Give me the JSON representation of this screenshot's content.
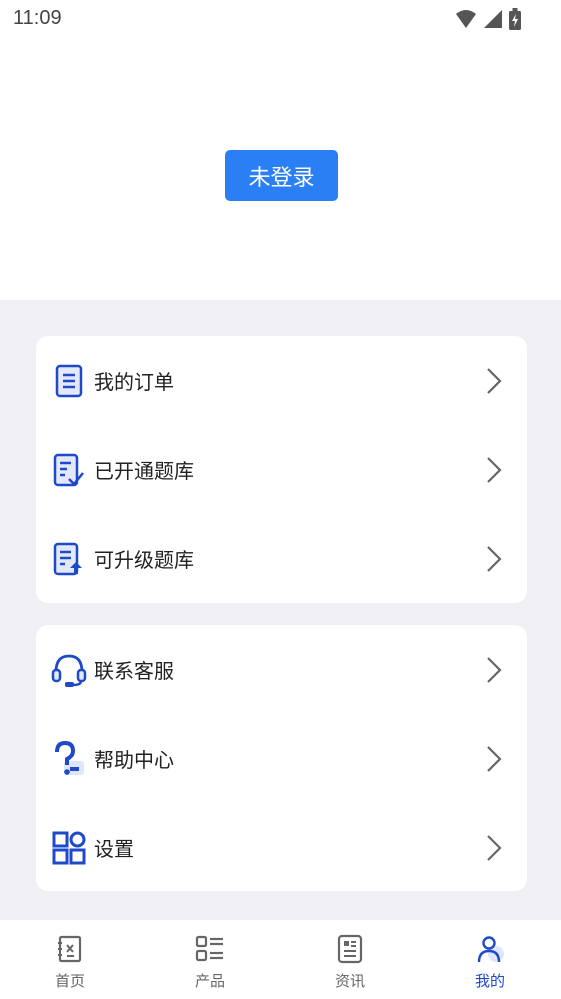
{
  "status_bar": {
    "time": "11:09"
  },
  "header": {
    "login_label": "未登录"
  },
  "menu_group1": {
    "items": [
      {
        "label": "我的订单",
        "icon": "order-icon"
      },
      {
        "label": "已开通题库",
        "icon": "opened-bank-icon"
      },
      {
        "label": "可升级题库",
        "icon": "upgrade-bank-icon"
      }
    ]
  },
  "menu_group2": {
    "items": [
      {
        "label": "联系客服",
        "icon": "headset-icon"
      },
      {
        "label": "帮助中心",
        "icon": "help-icon"
      },
      {
        "label": "设置",
        "icon": "settings-icon"
      }
    ]
  },
  "tabbar": {
    "tabs": [
      {
        "label": "首页",
        "icon": "home-icon"
      },
      {
        "label": "产品",
        "icon": "product-icon"
      },
      {
        "label": "资讯",
        "icon": "news-icon"
      },
      {
        "label": "我的",
        "icon": "profile-icon"
      }
    ],
    "active_index": 3
  },
  "colors": {
    "accent": "#2b7ff5",
    "icon_blue": "#1e49c9",
    "background": "#efeff4"
  }
}
